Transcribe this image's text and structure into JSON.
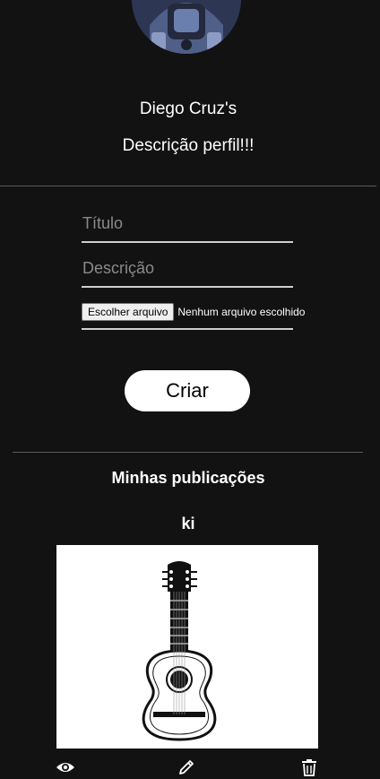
{
  "profile": {
    "name": "Diego Cruz's",
    "description": "Descrição perfil!!!"
  },
  "form": {
    "title_placeholder": "Título",
    "title_value": "",
    "description_placeholder": "Descrição",
    "description_value": "",
    "file_button_label": "Escolher arquivo",
    "file_status": "Nenhum arquivo escolhido",
    "submit_label": "Criar"
  },
  "publications": {
    "section_title": "Minhas publicações",
    "posts": [
      {
        "title": "ki",
        "actions": [
          "eye-icon",
          "pencil-icon",
          "trash-icon"
        ]
      }
    ]
  },
  "colors": {
    "background": "#121212",
    "text": "#ffffff",
    "button": "#ffffff",
    "divider": "#5a5a5a"
  }
}
